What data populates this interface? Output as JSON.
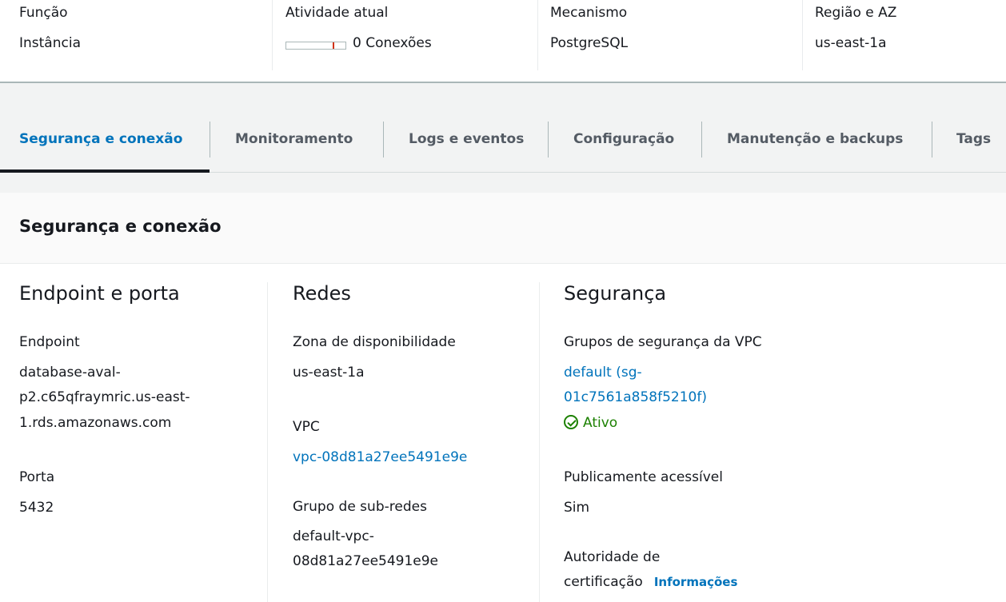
{
  "summary": {
    "cols": [
      {
        "label": "Função",
        "value": "Instância"
      },
      {
        "label": "Atividade atual",
        "value": "0 Conexões"
      },
      {
        "label": "Mecanismo",
        "value": "PostgreSQL"
      },
      {
        "label": "Região e AZ",
        "value": "us-east-1a"
      }
    ],
    "connections_level_fraction": 0
  },
  "tabs": [
    {
      "label": "Segurança e conexão",
      "active": true
    },
    {
      "label": "Monitoramento",
      "active": false
    },
    {
      "label": "Logs e eventos",
      "active": false
    },
    {
      "label": "Configuração",
      "active": false
    },
    {
      "label": "Manutenção e backups",
      "active": false
    },
    {
      "label": "Tags",
      "active": false
    }
  ],
  "panel": {
    "title": "Segurança e conexão",
    "endpoint": {
      "heading": "Endpoint e porta",
      "endpoint_label": "Endpoint",
      "endpoint_lines": [
        "database-aval-",
        "p2.c65qfraymric.us-east-",
        "1.rds.amazonaws.com"
      ],
      "port_label": "Porta",
      "port_value": "5432"
    },
    "networking": {
      "heading": "Redes",
      "az_label": "Zona de disponibilidade",
      "az_value": "us-east-1a",
      "vpc_label": "VPC",
      "vpc_value": "vpc-08d81a27ee5491e9e",
      "subnet_label": "Grupo de sub-redes",
      "subnet_lines": [
        "default-vpc-",
        "08d81a27ee5491e9e"
      ]
    },
    "security": {
      "heading": "Segurança",
      "sg_label": "Grupos de segurança da VPC",
      "sg_lines": [
        "default (sg-",
        "01c7561a858f5210f)"
      ],
      "sg_status": "Ativo",
      "public_label": "Publicamente acessível",
      "public_value": "Sim",
      "ca_label_lines": [
        "Autoridade de",
        "certificação"
      ],
      "ca_info": "Informações"
    }
  },
  "colors": {
    "link": "#0073bb",
    "success": "#1d8102",
    "text": "#16191f",
    "tab_inactive": "#545b64"
  }
}
